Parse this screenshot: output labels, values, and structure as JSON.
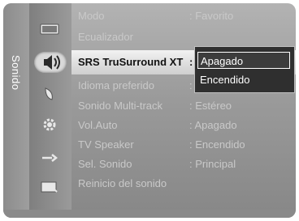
{
  "sidebar": {
    "label": "Sonido"
  },
  "icons": [
    "picture-icon",
    "sound-icon",
    "channel-icon",
    "settings-icon",
    "input-icon",
    "application-icon"
  ],
  "menu": [
    {
      "label": "Modo",
      "value": ": Favorito"
    },
    {
      "label": "Ecualizador",
      "value": ""
    },
    {
      "label": "SRS TruSurround XT",
      "value": ":"
    },
    {
      "label": "Idioma preferido",
      "value": ":"
    },
    {
      "label": "Sonido Multi-track",
      "value": ": Estéreo"
    },
    {
      "label": "Vol.Auto",
      "value": ": Apagado"
    },
    {
      "label": "TV Speaker",
      "value": ": Encendido"
    },
    {
      "label": "Sel. Sonido",
      "value": ": Principal"
    },
    {
      "label": "Reinicio del sonido",
      "value": ""
    }
  ],
  "popup": {
    "options": [
      "Apagado",
      "Encendido"
    ],
    "selected": "Apagado"
  },
  "colors": {
    "accent_highlight": "#e6e6e6",
    "popup_bg": "#2f2f2f",
    "menu_text": "#c9c9c9"
  }
}
